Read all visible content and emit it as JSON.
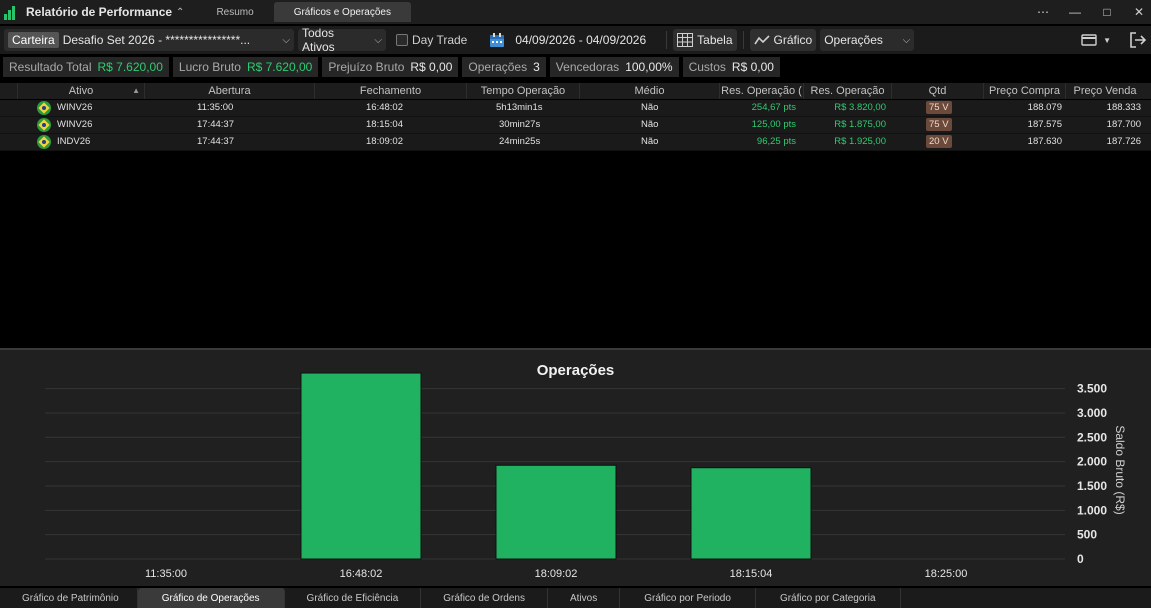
{
  "app": {
    "title": "Relatório de Performance",
    "tabs": [
      {
        "label": "Resumo",
        "active": false
      },
      {
        "label": "Gráficos e Operações",
        "active": true
      }
    ]
  },
  "toolbar": {
    "carteira_label": "Carteira",
    "account_value": "Desafio Set 2026 - ****************...",
    "assets_filter": "Todos Ativos",
    "day_trade_label": "Day Trade",
    "day_trade_checked": false,
    "date_range": "04/09/2026 - 04/09/2026",
    "tabela_label": "Tabela",
    "grafico_label": "Gráfico",
    "chart_type_value": "Operações"
  },
  "summary": [
    {
      "label": "Resultado Total",
      "value": "R$ 7.620,00",
      "color": "#2ecc71"
    },
    {
      "label": "Lucro Bruto",
      "value": "R$ 7.620,00",
      "color": "#2ecc71"
    },
    {
      "label": "Prejuízo Bruto",
      "value": "R$ 0,00",
      "color": "#e8e8e8"
    },
    {
      "label": "Operações",
      "value": "3",
      "color": "#e8e8e8"
    },
    {
      "label": "Vencedoras",
      "value": "100,00%",
      "color": "#e8e8e8"
    },
    {
      "label": "Custos",
      "value": "R$ 0,00",
      "color": "#e8e8e8"
    }
  ],
  "table": {
    "headers": [
      "Ativo",
      "Abertura",
      "Fechamento",
      "Tempo Operação",
      "Médio",
      "Res. Operação (",
      "Res. Operação",
      "Qtd",
      "Preço Compra",
      "Preço Venda"
    ],
    "rows": [
      {
        "ativo": "WINV26",
        "abertura": "11:35:00",
        "fechamento": "16:48:02",
        "tempo": "5h13min1s",
        "medio": "Não",
        "res_pts": "254,67 pts",
        "res_rs": "R$ 3.820,00",
        "qtd": "75 V",
        "compra": "188.079",
        "venda": "188.333"
      },
      {
        "ativo": "WINV26",
        "abertura": "17:44:37",
        "fechamento": "18:15:04",
        "tempo": "30min27s",
        "medio": "Não",
        "res_pts": "125,00 pts",
        "res_rs": "R$ 1.875,00",
        "qtd": "75 V",
        "compra": "187.575",
        "venda": "187.700"
      },
      {
        "ativo": "INDV26",
        "abertura": "17:44:37",
        "fechamento": "18:09:02",
        "tempo": "24min25s",
        "medio": "Não",
        "res_pts": "96,25 pts",
        "res_rs": "R$ 1.925,00",
        "qtd": "20 V",
        "compra": "187.630",
        "venda": "187.726"
      }
    ]
  },
  "chart_data": {
    "type": "bar",
    "title": "Operações",
    "ylabel": "Saldo Bruto (R$)",
    "xlabel": "",
    "x_ticks": [
      "11:35:00",
      "16:48:02",
      "18:09:02",
      "18:15:04",
      "18:25:00"
    ],
    "categories": [
      "16:48:02",
      "18:09:02",
      "18:15:04"
    ],
    "values": [
      3820,
      1925,
      1875
    ],
    "y_ticks": [
      "0",
      "500",
      "1.000",
      "1.500",
      "2.000",
      "2.500",
      "3.000",
      "3.500"
    ],
    "ylim": [
      0,
      3800
    ],
    "bar_color": "#21b261",
    "grid": true
  },
  "bottom_tabs": [
    {
      "label": "Gráfico de Patrimônio",
      "active": false
    },
    {
      "label": "Gráfico de Operações",
      "active": true
    },
    {
      "label": "Gráfico de Eficiência",
      "active": false
    },
    {
      "label": "Gráfico de Ordens",
      "active": false
    },
    {
      "label": "Ativos",
      "active": false
    },
    {
      "label": "Gráfico por Periodo",
      "active": false
    },
    {
      "label": "Gráfico por Categoria",
      "active": false
    }
  ]
}
